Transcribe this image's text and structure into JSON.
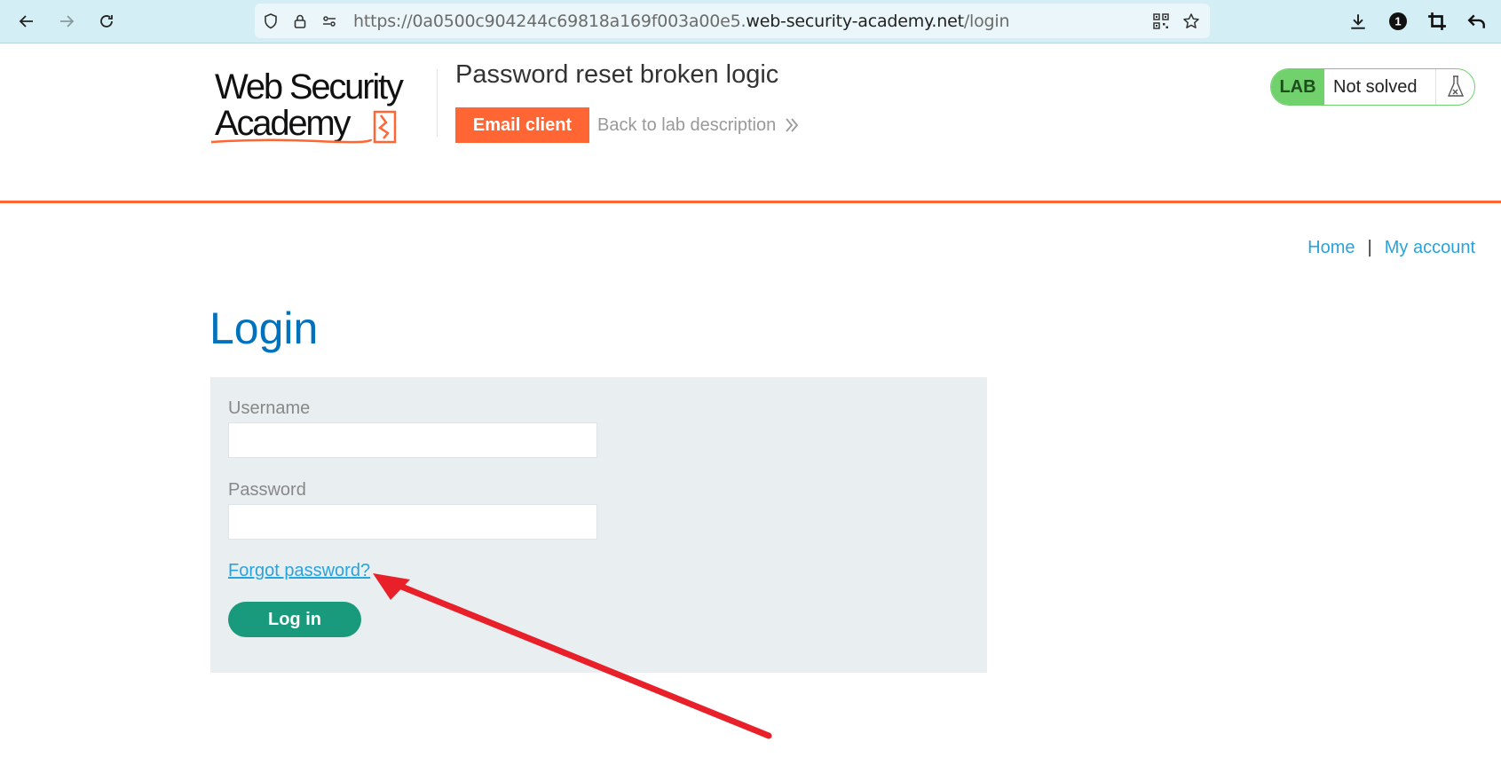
{
  "browser": {
    "url_prefix": "https://0a0500c904244c69818a169f003a00e5.",
    "url_host": "web-security-academy.net",
    "url_path": "/login",
    "extension_badge": "1"
  },
  "header": {
    "logo_line1": "Web Security",
    "logo_line2": "Academy",
    "lab_title": "Password reset broken logic",
    "email_client_label": "Email client",
    "back_link_label": "Back to lab description",
    "lab_tag": "LAB",
    "lab_status": "Not solved"
  },
  "nav": {
    "home": "Home",
    "separator": "|",
    "my_account": "My account"
  },
  "login": {
    "title": "Login",
    "username_label": "Username",
    "username_value": "",
    "password_label": "Password",
    "password_value": "",
    "forgot_label": "Forgot password?",
    "login_button": "Log in"
  },
  "colors": {
    "accent_orange": "#ff6633",
    "title_blue": "#0071bc",
    "link_blue": "#29a3db",
    "button_green": "#1a9a7c",
    "lab_green": "#70d16d",
    "annotation_red": "#e8202a"
  }
}
